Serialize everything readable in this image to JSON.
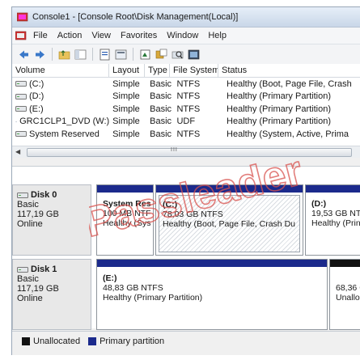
{
  "window": {
    "title": "Console1 - [Console Root\\Disk Management(Local)]"
  },
  "menu": [
    "File",
    "Action",
    "View",
    "Favorites",
    "Window",
    "Help"
  ],
  "toolbar": {
    "icons": [
      "back-arrow-icon",
      "forward-arrow-icon",
      "up-folder-icon",
      "show-hide-tree-icon",
      "properties-icon",
      "help-icon",
      "rescan-icon",
      "connect-icon",
      "search-disk-icon",
      "console-icon"
    ]
  },
  "volume_list": {
    "columns": [
      "Volume",
      "Layout",
      "Type",
      "File System",
      "Status"
    ],
    "rows": [
      {
        "volume": "(C:)",
        "layout": "Simple",
        "type": "Basic",
        "fs": "NTFS",
        "status": "Healthy (Boot, Page File, Crash"
      },
      {
        "volume": "(D:)",
        "layout": "Simple",
        "type": "Basic",
        "fs": "NTFS",
        "status": "Healthy (Primary Partition)"
      },
      {
        "volume": "(E:)",
        "layout": "Simple",
        "type": "Basic",
        "fs": "NTFS",
        "status": "Healthy (Primary Partition)"
      },
      {
        "volume": "GRC1CLP1_DVD (W:)",
        "layout": "Simple",
        "type": "Basic",
        "fs": "UDF",
        "status": "Healthy (Primary Partition)"
      },
      {
        "volume": "System Reserved",
        "layout": "Simple",
        "type": "Basic",
        "fs": "NTFS",
        "status": "Healthy (System, Active, Prima"
      }
    ],
    "scroll_grip": "III"
  },
  "disks": [
    {
      "name": "Disk 0",
      "kind": "Basic",
      "size": "117,19 GB",
      "state": "Online",
      "partitions": [
        {
          "name": "System Res",
          "size": "100 MB NTF",
          "status": "Healthy (Sys"
        },
        {
          "name": "(C:)",
          "size": "78,03 GB NTFS",
          "status": "Healthy (Boot, Page File, Crash Du"
        },
        {
          "name": "(D:)",
          "size": "19,53 GB NTF",
          "status": "Healthy (Prin"
        }
      ]
    },
    {
      "name": "Disk 1",
      "kind": "Basic",
      "size": "117,19 GB",
      "state": "Online",
      "partitions": [
        {
          "name": "(E:)",
          "size": "48,83 GB NTFS",
          "status": "Healthy (Primary Partition)"
        },
        {
          "name": "",
          "size": "68,36 G",
          "status": "Unalloc"
        }
      ]
    }
  ],
  "legend": {
    "unallocated": "Unallocated",
    "primary": "Primary partition"
  },
  "colors": {
    "primary": "#1b2a8c",
    "unallocated": "#111111",
    "watermark": "#d9534f"
  },
  "watermark": "Passleader"
}
